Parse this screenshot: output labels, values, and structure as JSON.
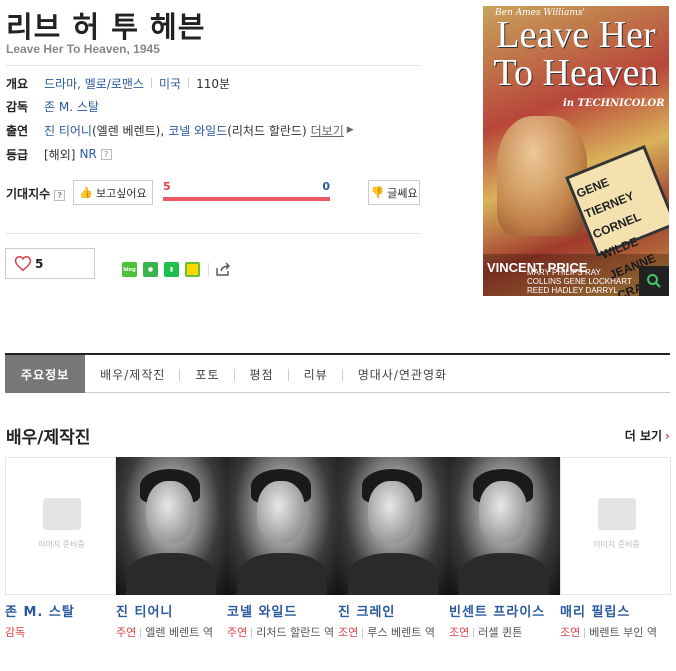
{
  "movie": {
    "title": "리브 허 투 헤븐",
    "original_title": "Leave Her To Heaven, 1945"
  },
  "info": {
    "overview_label": "개요",
    "genre": "드라마, 멜로/로맨스",
    "country": "미국",
    "runtime": "110분",
    "director_label": "감독",
    "director": "존 M. 스탈",
    "cast_label": "출연",
    "cast_actor1": "진 티어니",
    "cast_role1": "(엘렌 베렌트),",
    "cast_actor2": "코넬 와일드",
    "cast_role2": "(리처드 할란드)",
    "more_label": "더보기",
    "rating_label": "등급",
    "rating_region": "[해외]",
    "rating": "NR"
  },
  "expect": {
    "label": "기대지수",
    "want_label": "보고싶어요",
    "no_label": "글쎄요",
    "want_count": "5",
    "no_count": "0",
    "want_ratio": 1.0
  },
  "like": {
    "count": "5"
  },
  "share": {
    "blog_label": "blog"
  },
  "poster": {
    "top_credit": "Ben Ames Williams'",
    "title": "Leave Her To Heaven",
    "technicolor": "in TECHNICOLOR",
    "names": [
      "GENE TIERNEY",
      "CORNEL WILDE",
      "JEANNE CRAIN"
    ],
    "bottom_name": "VINCENT PRICE",
    "bottom_credits": "MARY PHILIPS  RAY COLLINS  GENE LOCKHART  REED HADLEY  DARRYL HICKMAN  CHILL WILLS  STAHL"
  },
  "tabs": [
    "주요정보",
    "배우/제작진",
    "포토",
    "평점",
    "리뷰",
    "명대사/연관영화"
  ],
  "cast_section": {
    "title": "배우/제작진",
    "more": "더 보기",
    "no_image_text": "이미지 준비중",
    "people": [
      {
        "name": "존 M. 스탈",
        "kind": "감독",
        "role": "",
        "photo": false
      },
      {
        "name": "진 티어니",
        "kind": "주연",
        "role": "엘렌 베렌트 역",
        "photo": true
      },
      {
        "name": "코넬 와일드",
        "kind": "주연",
        "role": "리처드 할란드 역",
        "photo": true
      },
      {
        "name": "진 크레인",
        "kind": "조연",
        "role": "루스 베렌트 역",
        "photo": true
      },
      {
        "name": "빈센트 프라이스",
        "kind": "조연",
        "role": "러셀 퀸튼",
        "photo": true
      },
      {
        "name": "매리 필립스",
        "kind": "조연",
        "role": "베렌트 부인 역",
        "photo": false
      }
    ]
  },
  "colors": {
    "link": "#2a5aa0",
    "accent_red": "#e0404a",
    "tab_active_bg": "#777777"
  }
}
